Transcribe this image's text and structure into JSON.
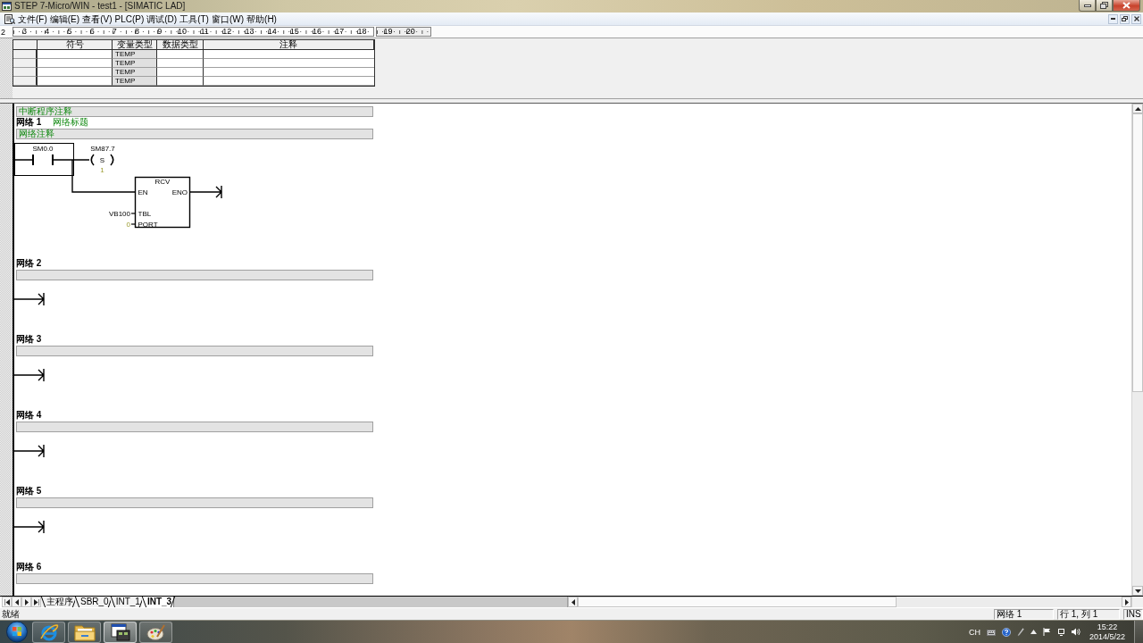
{
  "window": {
    "title": "STEP 7-Micro/WIN - test1 - [SIMATIC LAD]"
  },
  "menu_bar": {
    "items": [
      "文件(F)",
      "编辑(E)",
      "查看(V)",
      "PLC(P)",
      "调试(D)",
      "工具(T)",
      "窗口(W)",
      "帮助(H)"
    ]
  },
  "ruler": {
    "leading_mark": "2",
    "marks": [
      "3",
      "4",
      "5",
      "6",
      "7",
      "8",
      "9",
      "10",
      "11",
      "12",
      "13",
      "14",
      "15",
      "16",
      "17",
      "18"
    ],
    "overflow_marks": [
      "19",
      "20"
    ]
  },
  "variable_table": {
    "columns": [
      "符号",
      "变量类型",
      "数据类型",
      "注释"
    ],
    "rows": [
      {
        "variable_type": "TEMP"
      },
      {
        "variable_type": "TEMP"
      },
      {
        "variable_type": "TEMP"
      },
      {
        "variable_type": "TEMP"
      }
    ]
  },
  "editor": {
    "program_comment": "中断程序注释",
    "networks": [
      {
        "label": "网络 1",
        "title": "网络标题",
        "comment": "网络注释",
        "rung": {
          "kind": "ladder",
          "contact": {
            "address": "SM0.0",
            "selected": true
          },
          "coil": {
            "address": "SM87.7",
            "instruction": "S",
            "count": "1",
            "selected": false
          },
          "box": {
            "name": "RCV",
            "enable_in": "EN",
            "enable_out": "ENO",
            "inputs": [
              {
                "pin": "TBL",
                "operand": "VB100",
                "kind": "address"
              },
              {
                "pin": "PORT",
                "operand": "0",
                "kind": "constant"
              }
            ],
            "selected": false
          }
        }
      },
      {
        "label": "网络 2",
        "rung": {
          "kind": "empty"
        }
      },
      {
        "label": "网络 3",
        "rung": {
          "kind": "empty"
        }
      },
      {
        "label": "网络 4",
        "rung": {
          "kind": "empty"
        }
      },
      {
        "label": "网络 5",
        "rung": {
          "kind": "empty"
        }
      },
      {
        "label": "网络 6"
      }
    ]
  },
  "sheet_tabs": [
    {
      "label": "主程序",
      "selected": false
    },
    {
      "label": "SBR_0",
      "selected": false
    },
    {
      "label": "INT_1",
      "selected": false
    },
    {
      "label": "INT_3",
      "selected": true
    }
  ],
  "status_bar": {
    "message": "就绪",
    "network": "网络 1",
    "position": "行 1, 列 1",
    "mode": "INS"
  },
  "taskbar": {
    "apps": [
      {
        "kind": "browser",
        "selected": false
      },
      {
        "kind": "folder",
        "selected": false
      },
      {
        "kind": "plc-editor",
        "selected": true
      },
      {
        "kind": "paint",
        "selected": false
      }
    ],
    "tray": {
      "language": "CH",
      "time": "15:22",
      "date": "2014/5/22"
    }
  }
}
